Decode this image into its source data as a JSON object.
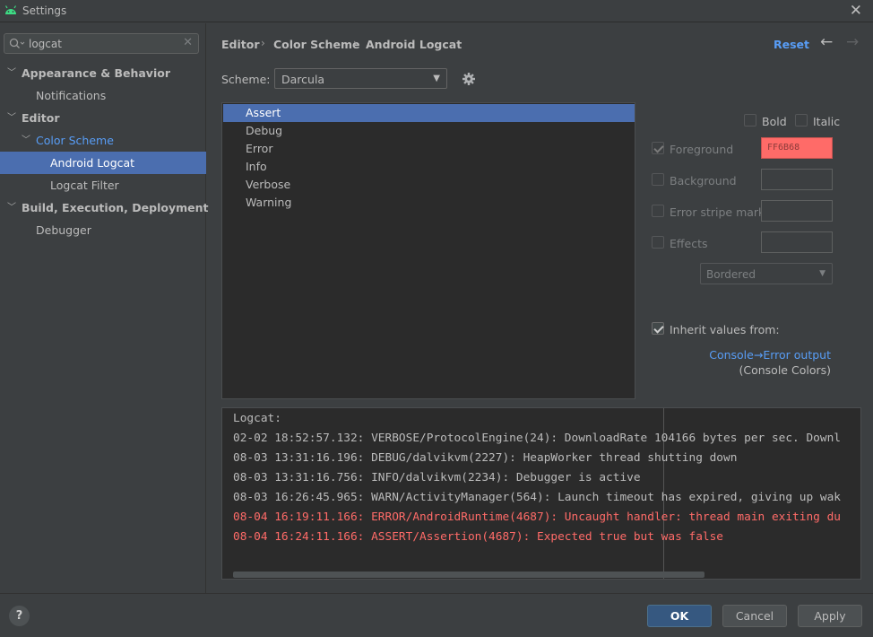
{
  "window": {
    "title": "Settings"
  },
  "search": {
    "value": "logcat"
  },
  "sidebar": {
    "items": [
      {
        "label": "Appearance & Behavior"
      },
      {
        "label": "Notifications"
      },
      {
        "label": "Editor"
      },
      {
        "label": "Color Scheme"
      },
      {
        "label": "Android Logcat"
      },
      {
        "label": "Logcat Filter"
      },
      {
        "label": "Build, Execution, Deployment"
      },
      {
        "label": "Debugger"
      }
    ]
  },
  "breadcrumb": {
    "items": [
      "Editor",
      "Color Scheme",
      "Android Logcat"
    ],
    "separator": "›"
  },
  "header": {
    "reset_label": "Reset"
  },
  "scheme": {
    "label": "Scheme:",
    "value": "Darcula"
  },
  "levels": [
    "Assert",
    "Debug",
    "Error",
    "Info",
    "Verbose",
    "Warning"
  ],
  "options": {
    "bold_label": "Bold",
    "italic_label": "Italic",
    "foreground_label": "Foreground",
    "foreground_value": "FF6B68",
    "foreground_color": "#ff6b68",
    "background_label": "Background",
    "error_stripe_label": "Error stripe mark",
    "effects_label": "Effects",
    "effect_type": "Bordered",
    "inherit_label": "Inherit values from:",
    "inherit_link": "Console→Error output",
    "inherit_sub": "(Console Colors)"
  },
  "preview": {
    "lines": [
      "Logcat:",
      "02-02 18:52:57.132: VERBOSE/ProtocolEngine(24): DownloadRate 104166 bytes per sec. Downl",
      "08-03 13:31:16.196: DEBUG/dalvikvm(2227): HeapWorker thread shutting down",
      "08-03 13:31:16.756: INFO/dalvikvm(2234): Debugger is active",
      "08-03 16:26:45.965: WARN/ActivityManager(564): Launch timeout has expired, giving up wak",
      "08-04 16:19:11.166: ERROR/AndroidRuntime(4687): Uncaught handler: thread main exiting du",
      "08-04 16:24:11.166: ASSERT/Assertion(4687): Expected true but was false"
    ]
  },
  "footer": {
    "help_label": "?",
    "ok_label": "OK",
    "cancel_label": "Cancel",
    "apply_label": "Apply"
  },
  "colors": {
    "accent": "#4b6eaf",
    "link": "#589df6",
    "error_text": "#ff6b68"
  }
}
